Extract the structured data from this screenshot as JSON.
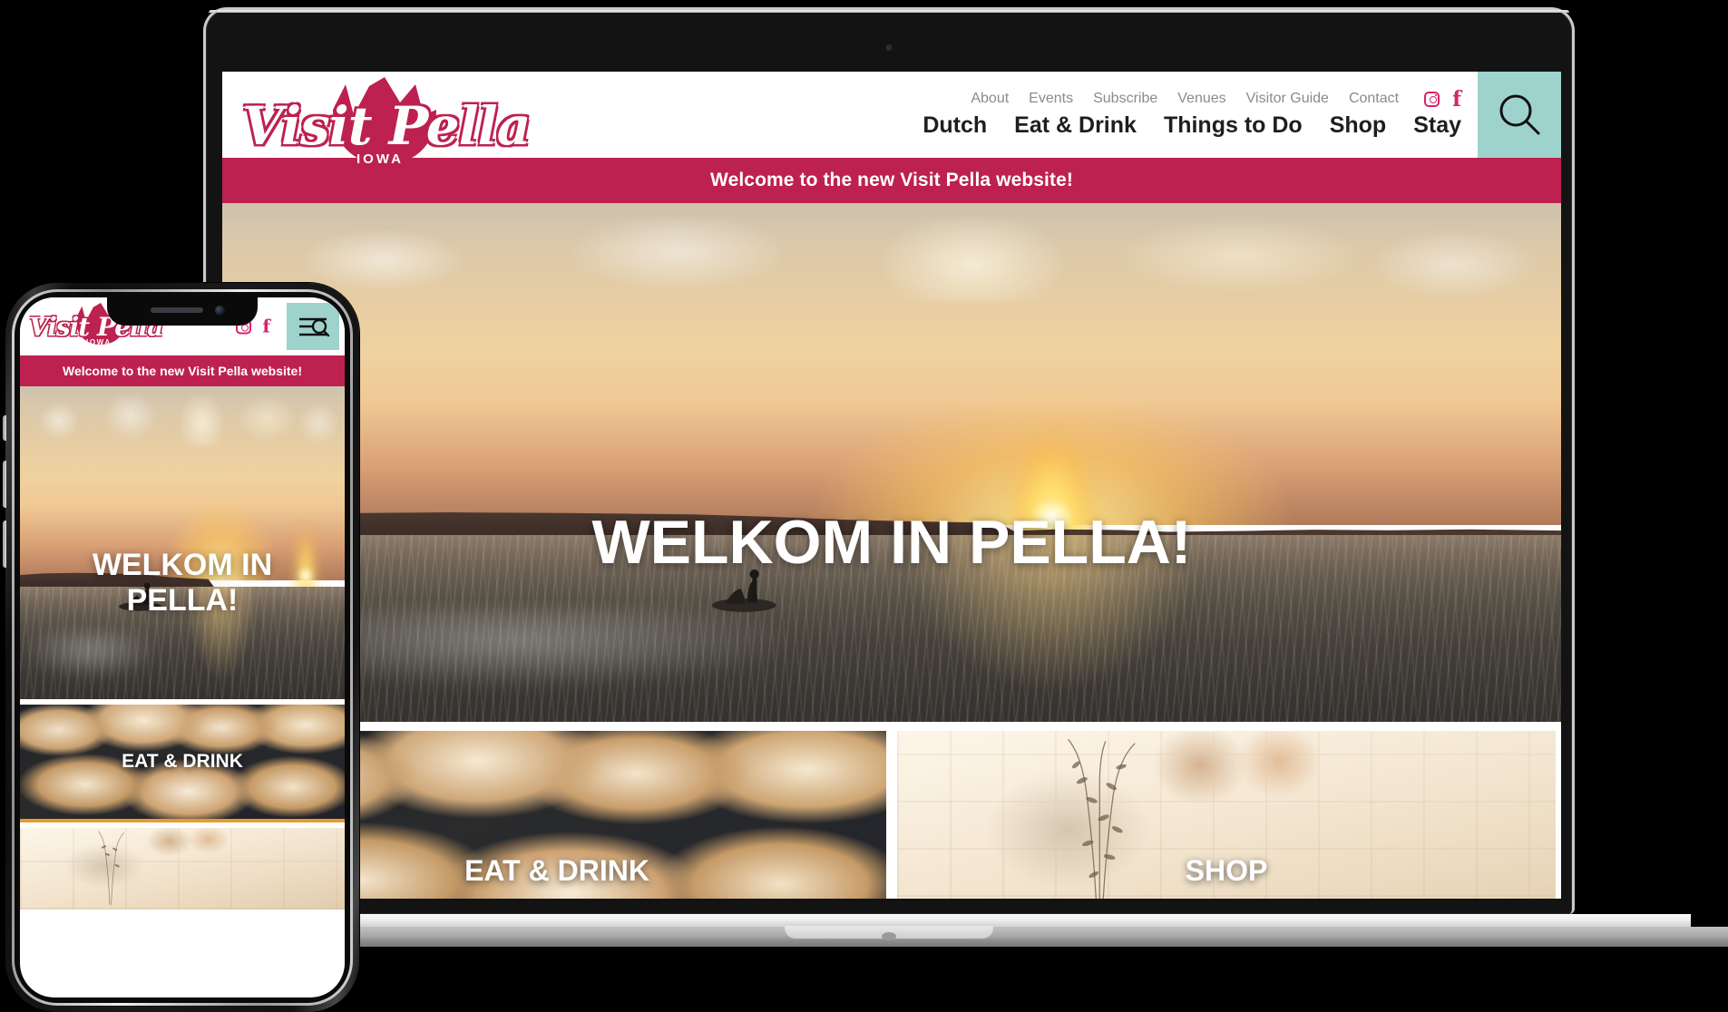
{
  "site": {
    "brand": {
      "name": "Visit Pella",
      "state": "IOWA",
      "logo_icon": "tulip-icon"
    },
    "announcement": "Welcome to the new Visit Pella website!",
    "colors": {
      "brand_pink": "#BD2150",
      "accent_teal": "#9ED3CD",
      "divider_orange": "#E79B2F",
      "nav_text": "#1E1E1E",
      "utility_text": "#8B8B8B"
    },
    "utility_nav": [
      {
        "label": "About"
      },
      {
        "label": "Events"
      },
      {
        "label": "Subscribe"
      },
      {
        "label": "Venues"
      },
      {
        "label": "Visitor Guide"
      },
      {
        "label": "Contact"
      }
    ],
    "social": [
      {
        "name": "instagram-icon"
      },
      {
        "name": "facebook-icon"
      }
    ],
    "main_nav": [
      {
        "label": "Dutch"
      },
      {
        "label": "Eat & Drink"
      },
      {
        "label": "Things to Do"
      },
      {
        "label": "Shop"
      },
      {
        "label": "Stay"
      }
    ],
    "search": {
      "icon": "search-icon",
      "label": "Search"
    },
    "hero": {
      "title": "WELKOM IN PELLA!",
      "image_alt": "boat-on-lake-at-sunset"
    },
    "cards": [
      {
        "label": "EAT & DRINK",
        "image_alt": "dutch-letters-pastry"
      },
      {
        "label": "SHOP",
        "image_alt": "boutique-shelves"
      }
    ],
    "mobile": {
      "menu_icon": "hamburger-search-icon",
      "hero_title_lines": [
        "WELKOM IN",
        "PELLA!"
      ]
    }
  },
  "devices": {
    "laptop": {
      "name": "laptop-mockup",
      "camera": "webcam-icon"
    },
    "phone": {
      "name": "phone-mockup",
      "camera": "front-camera-icon",
      "speaker": "earpiece-speaker"
    }
  }
}
